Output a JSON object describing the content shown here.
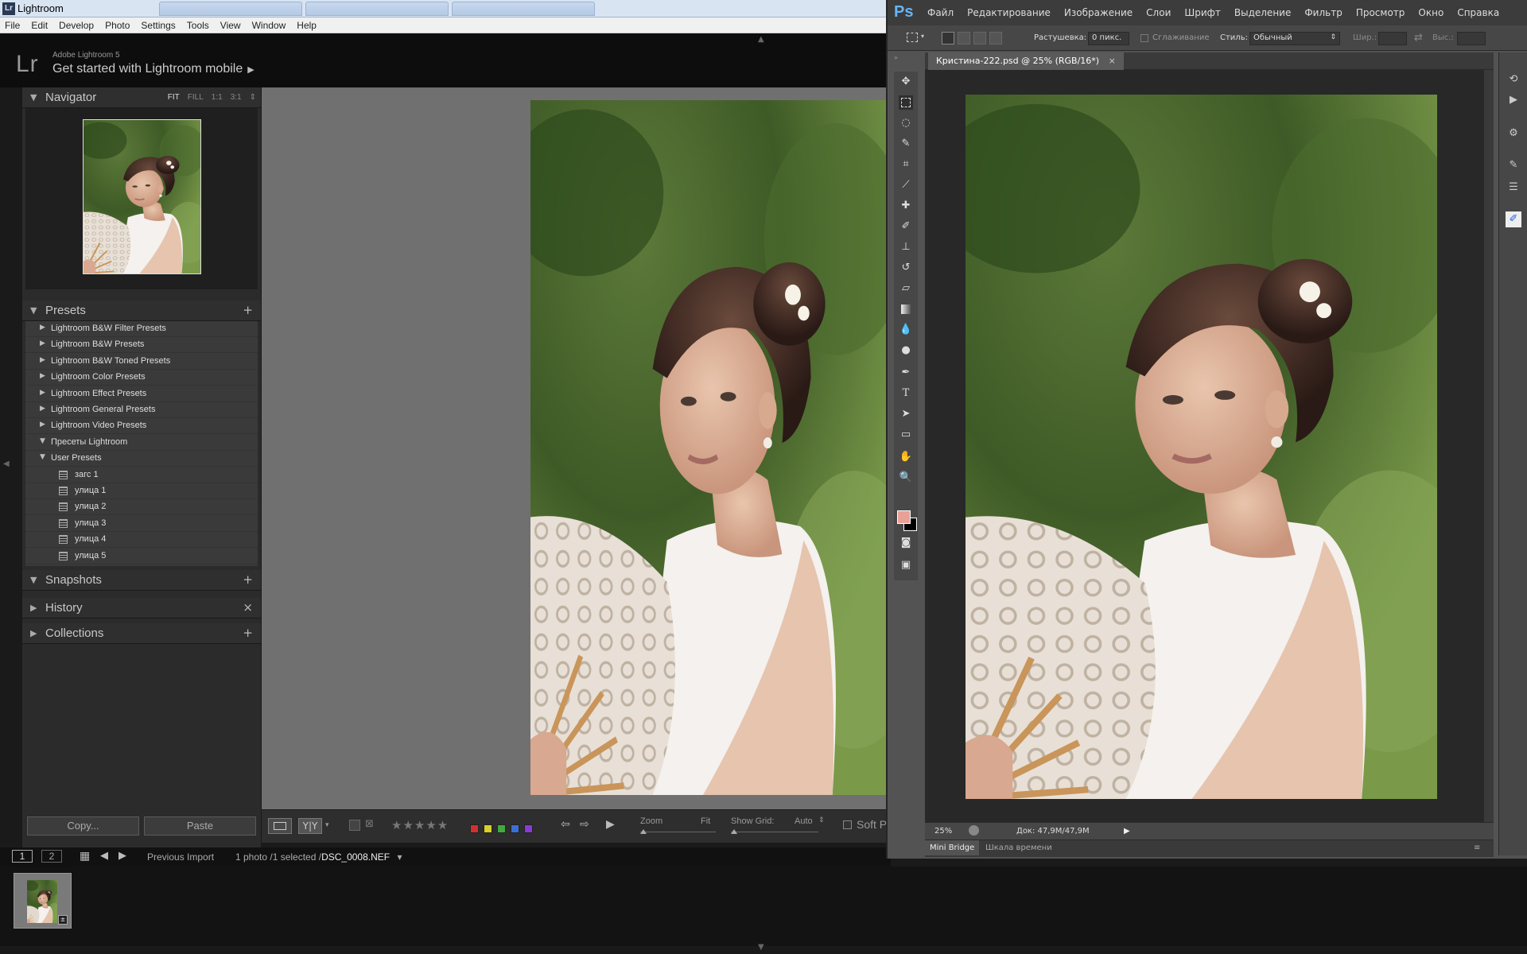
{
  "lightroom": {
    "app_icon": "Lr",
    "window_title": "Lightroom",
    "menu": [
      "File",
      "Edit",
      "Develop",
      "Photo",
      "Settings",
      "Tools",
      "View",
      "Window",
      "Help"
    ],
    "logo": "Lr",
    "version": "Adobe Lightroom 5",
    "mobile_prompt": "Get started with Lightroom mobile",
    "mobile_arrow": "▶",
    "navigator": {
      "title": "Navigator",
      "zoom_options": [
        "FIT",
        "FILL",
        "1:1",
        "3:1"
      ]
    },
    "presets": {
      "title": "Presets",
      "items": [
        {
          "label": "Lightroom B&W Filter Presets",
          "kind": "folder",
          "expanded": false
        },
        {
          "label": "Lightroom B&W Presets",
          "kind": "folder",
          "expanded": false
        },
        {
          "label": "Lightroom B&W Toned Presets",
          "kind": "folder",
          "expanded": false
        },
        {
          "label": "Lightroom Color Presets",
          "kind": "folder",
          "expanded": false
        },
        {
          "label": "Lightroom Effect Presets",
          "kind": "folder",
          "expanded": false
        },
        {
          "label": "Lightroom General Presets",
          "kind": "folder",
          "expanded": false
        },
        {
          "label": "Lightroom Video Presets",
          "kind": "folder",
          "expanded": false
        },
        {
          "label": "Пресеты Lightroom",
          "kind": "folder",
          "expanded": true
        },
        {
          "label": "User Presets",
          "kind": "folder",
          "expanded": true
        },
        {
          "label": "загс 1",
          "kind": "preset"
        },
        {
          "label": "улица 1",
          "kind": "preset"
        },
        {
          "label": "улица 2",
          "kind": "preset"
        },
        {
          "label": "улица 3",
          "kind": "preset"
        },
        {
          "label": "улица 4",
          "kind": "preset"
        },
        {
          "label": "улица 5",
          "kind": "preset"
        }
      ]
    },
    "snapshots": {
      "title": "Snapshots"
    },
    "history": {
      "title": "History"
    },
    "collections": {
      "title": "Collections"
    },
    "copy_button": "Copy...",
    "paste_button": "Paste",
    "toolbar": {
      "zoom_label": "Zoom",
      "zoom_value": "Fit",
      "show_grid_label": "Show Grid:",
      "show_grid_value": "Auto",
      "soft_proofing_label": "Soft P",
      "stars": "★★★★★",
      "color_labels": [
        "#d23030",
        "#d8d028",
        "#3faa3f",
        "#3a6fd6",
        "#8a3ad6"
      ]
    },
    "filmstrip": {
      "monitor_1": "1",
      "monitor_2": "2",
      "source": "Previous Import",
      "selection": "1 photo /1 selected /",
      "filename": "DSC_0008.NEF",
      "dropdown": "▾"
    }
  },
  "photoshop": {
    "logo": "Ps",
    "menu": [
      "Файл",
      "Редактирование",
      "Изображение",
      "Слои",
      "Шрифт",
      "Выделение",
      "Фильтр",
      "Просмотр",
      "Окно",
      "Справка"
    ],
    "options": {
      "feather_label": "Растушевка:",
      "feather_value": "0 пикс.",
      "antialias_label": "Сглаживание",
      "style_label": "Стиль:",
      "style_value": "Обычный",
      "width_label": "Шир.:",
      "height_label": "Выс.:"
    },
    "doc_tab": "Кристина-222.psd @ 25% (RGB/16*)",
    "doc_tab_close": "×",
    "status": {
      "zoom": "25%",
      "doc_size": "Док: 47,9M/47,9M"
    },
    "bottom_tabs": [
      "Mini Bridge",
      "Шкала времени"
    ]
  },
  "colors": {
    "ps_foreground": "#e8a097",
    "ps_background": "#000000",
    "ps_accent": "#66b4f6"
  }
}
